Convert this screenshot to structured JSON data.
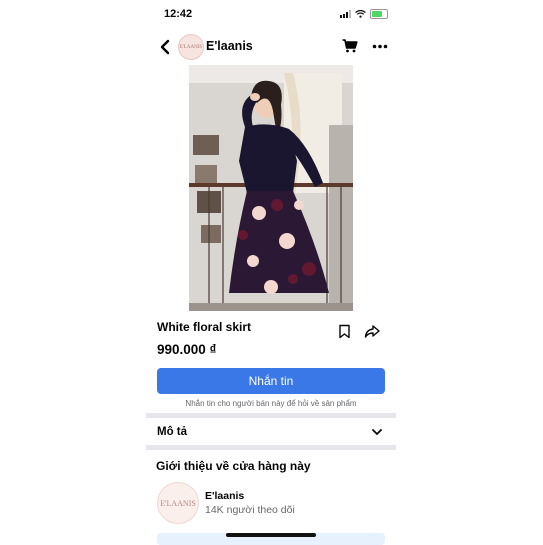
{
  "status_bar": {
    "time": "12:42"
  },
  "header": {
    "store_name": "E'laanis",
    "avatar_text": "E'LAANIS"
  },
  "product": {
    "title": "White floral skirt",
    "price": "990.000 ₫"
  },
  "actions": {
    "message_button": "Nhắn tin",
    "message_hint": "Nhắn tin cho người bán này để hỏi về sản phẩm"
  },
  "description": {
    "label": "Mô tả"
  },
  "about": {
    "title": "Giới thiệu về cửa hàng này",
    "store_name": "E'laanis",
    "logo_text": "E'LAANIS",
    "followers": "14K người theo dõi"
  },
  "colors": {
    "accent": "#3b78e7",
    "divider": "#e6e7eb",
    "muted_text": "#65676b"
  },
  "icons": [
    "back-icon",
    "cart-icon",
    "more-icon",
    "bookmark-icon",
    "share-icon",
    "chevron-down-icon"
  ]
}
